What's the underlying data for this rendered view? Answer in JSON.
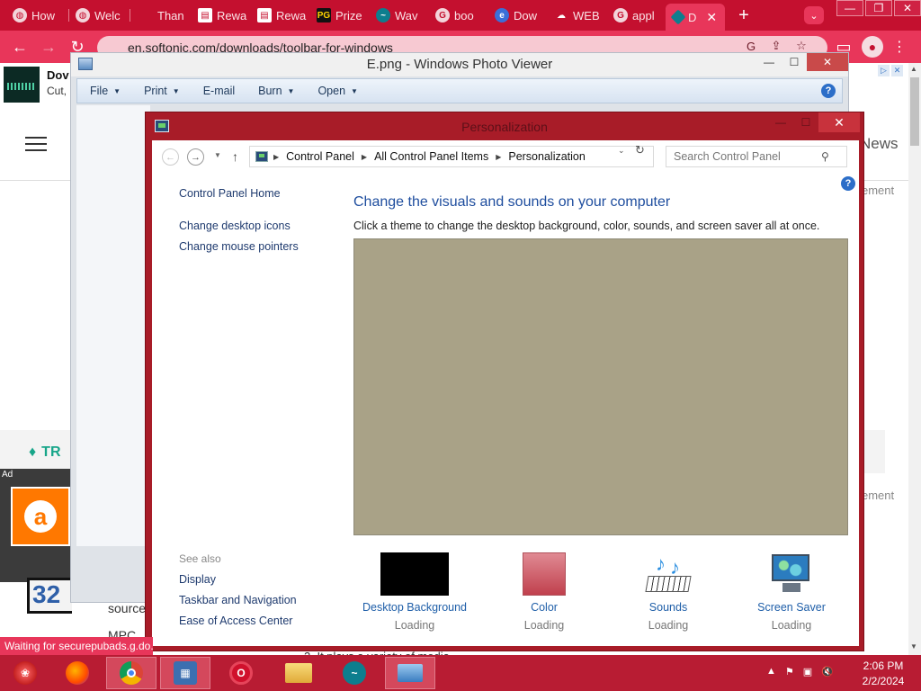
{
  "browser": {
    "tabs": [
      {
        "label": "How",
        "icon": "globe-icon"
      },
      {
        "label": "Welc",
        "icon": "globe-icon"
      },
      {
        "label": "Than",
        "icon": "blank-icon"
      },
      {
        "label": "Rewa",
        "icon": "doc-icon"
      },
      {
        "label": "Rewa",
        "icon": "doc-icon"
      },
      {
        "label": "Prize",
        "icon": "pg-icon"
      },
      {
        "label": "Wav",
        "icon": "wave-icon"
      },
      {
        "label": "boo",
        "icon": "google-icon"
      },
      {
        "label": "Dow",
        "icon": "edge-icon"
      },
      {
        "label": "WEB",
        "icon": "cloud-icon"
      },
      {
        "label": "appl",
        "icon": "google-icon"
      },
      {
        "label": "D",
        "icon": "diamond-icon"
      }
    ],
    "url": "en.softonic.com/downloads/toolbar-for-windows",
    "new_tab": "+",
    "status": "Waiting for securepubads.g.do..."
  },
  "webpage": {
    "ad_title": "Dov",
    "ad_sub": "Cut,",
    "news": "News",
    "edge_text_1": "ement",
    "edge_text_2": "ement",
    "tr_text": "TR",
    "ad_label": "Ad",
    "avast_letter": "a",
    "logo_text": "32",
    "source_text": "source",
    "mpc_text": "MPC",
    "bottom_text": "2. It plays a variety of media"
  },
  "photo_viewer": {
    "title": "E.png - Windows Photo Viewer",
    "menu": [
      "File",
      "Print",
      "E-mail",
      "Burn",
      "Open"
    ],
    "help": "?"
  },
  "personalization": {
    "title": "Personalization",
    "breadcrumb": [
      "Control Panel",
      "All Control Panel Items",
      "Personalization"
    ],
    "search_placeholder": "Search Control Panel",
    "help": "?",
    "left_nav": [
      "Control Panel Home",
      "Change desktop icons",
      "Change mouse pointers"
    ],
    "see_also_label": "See also",
    "see_also": [
      "Display",
      "Taskbar and Navigation",
      "Ease of Access Center"
    ],
    "heading": "Change the visuals and sounds on your computer",
    "description": "Click a theme to change the desktop background, color, sounds, and screen saver all at once.",
    "tiles": [
      {
        "label": "Desktop Background",
        "state": "Loading"
      },
      {
        "label": "Color",
        "state": "Loading"
      },
      {
        "label": "Sounds",
        "state": "Loading"
      },
      {
        "label": "Screen Saver",
        "state": "Loading"
      }
    ]
  },
  "taskbar": {
    "apps": [
      "start-orb-icon",
      "firefox-icon",
      "chrome-icon",
      "control-panel-icon",
      "opera-icon",
      "file-explorer-icon",
      "wave-app-icon",
      "photo-viewer-icon"
    ],
    "time": "2:06 PM",
    "date": "2/2/2024"
  },
  "colors": {
    "chrome_frame": "#c4102f",
    "window_border": "#a81c28",
    "link": "#1e3a6e",
    "heading_blue": "#1e4d9e",
    "theme_preview": "#a9a287"
  }
}
